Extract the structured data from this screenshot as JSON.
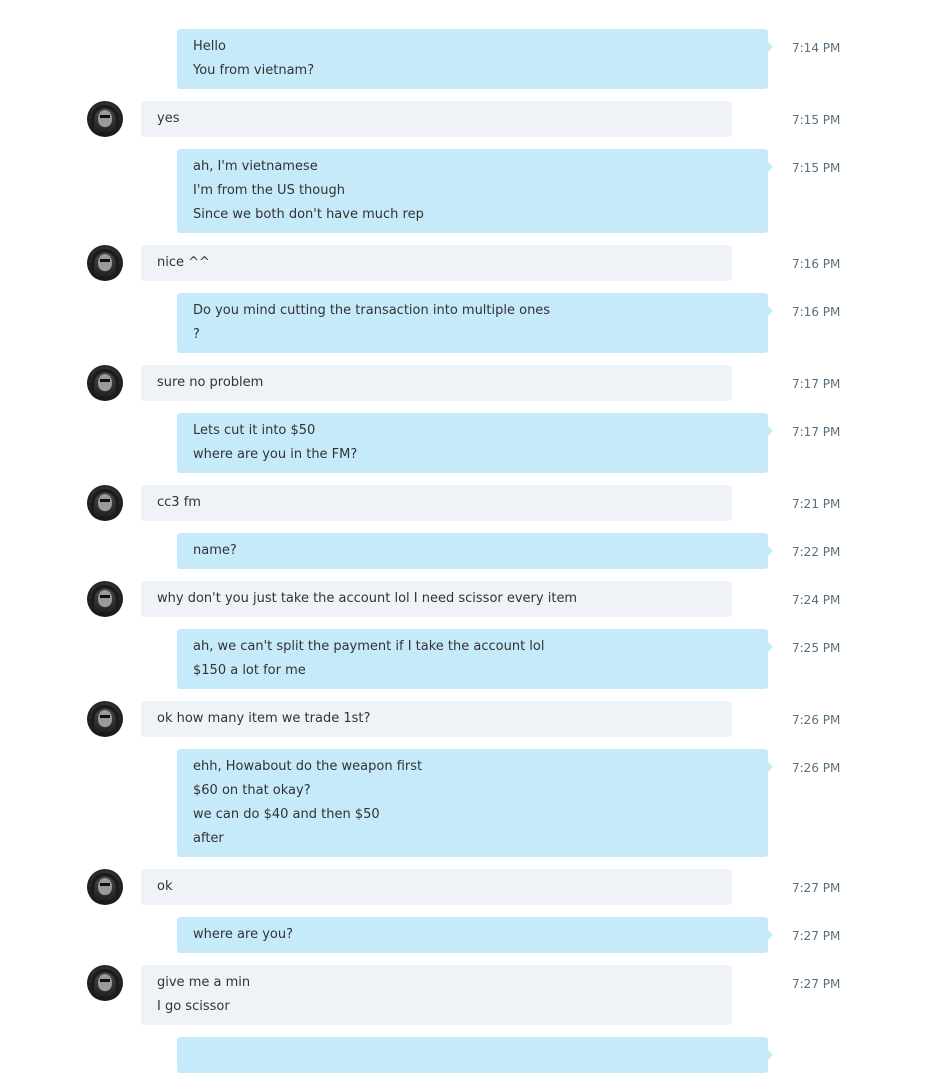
{
  "colors": {
    "outgoing_bubble": "#c7eafb",
    "incoming_bubble": "#eff2f7",
    "time_text": "#5a6f7d"
  },
  "messages": [
    {
      "dir": "out",
      "time": "7:14 PM",
      "lines": [
        "Hello",
        "You from vietnam?"
      ]
    },
    {
      "dir": "in",
      "time": "7:15 PM",
      "lines": [
        "yes"
      ]
    },
    {
      "dir": "out",
      "time": "7:15 PM",
      "lines": [
        "ah, I'm vietnamese",
        "I'm from the US though",
        "Since we both don't have much rep"
      ]
    },
    {
      "dir": "in",
      "time": "7:16 PM",
      "lines": [
        "nice ^^"
      ]
    },
    {
      "dir": "out",
      "time": "7:16 PM",
      "lines": [
        "Do you mind cutting the transaction into multiple ones",
        "?"
      ]
    },
    {
      "dir": "in",
      "time": "7:17 PM",
      "lines": [
        "sure no problem"
      ]
    },
    {
      "dir": "out",
      "time": "7:17 PM",
      "lines": [
        "Lets cut it into $50",
        "where are you in the FM?"
      ]
    },
    {
      "dir": "in",
      "time": "7:21 PM",
      "lines": [
        "cc3 fm"
      ]
    },
    {
      "dir": "out",
      "time": "7:22 PM",
      "lines": [
        "name?"
      ]
    },
    {
      "dir": "in",
      "time": "7:24 PM",
      "lines": [
        "why don't you just take the account lol I need scissor every item"
      ]
    },
    {
      "dir": "out",
      "time": "7:25 PM",
      "lines": [
        "ah, we can't split the payment if I take the account lol",
        "$150 a lot for me"
      ]
    },
    {
      "dir": "in",
      "time": "7:26 PM",
      "lines": [
        "ok how many item we trade 1st?"
      ]
    },
    {
      "dir": "out",
      "time": "7:26 PM",
      "lines": [
        "ehh, Howabout do the weapon first",
        "$60 on that okay?",
        "we can do $40 and then $50",
        "after"
      ]
    },
    {
      "dir": "in",
      "time": "7:27 PM",
      "lines": [
        "ok"
      ]
    },
    {
      "dir": "out",
      "time": "7:27 PM",
      "lines": [
        "where are you?"
      ]
    },
    {
      "dir": "in",
      "time": "7:27 PM",
      "lines": [
        "give me a min",
        "I go scissor"
      ]
    },
    {
      "dir": "out",
      "time": "",
      "lines": [
        ""
      ]
    }
  ]
}
